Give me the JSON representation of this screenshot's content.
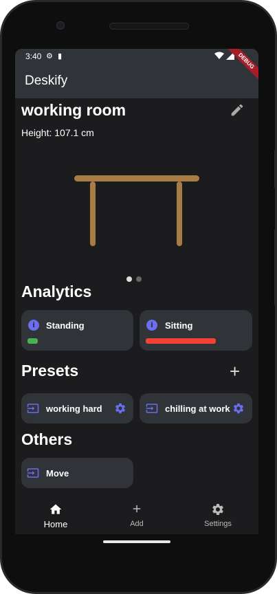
{
  "status": {
    "time": "3:40"
  },
  "appbar": {
    "title": "Deskify",
    "debug_banner": "DEBUG"
  },
  "room": {
    "name": "working room",
    "height_text": "Height: 107.1 cm"
  },
  "carousel": {
    "page_count": 2,
    "active_index": 0
  },
  "analytics": {
    "heading": "Analytics",
    "cards": [
      {
        "label": "Standing",
        "bar_color": "#4caf50",
        "ratio": 0.11
      },
      {
        "label": "Sitting",
        "bar_color": "#f44336",
        "ratio": 0.75
      }
    ]
  },
  "presets": {
    "heading": "Presets",
    "items": [
      {
        "label": "working hard"
      },
      {
        "label": "chilling at work"
      }
    ]
  },
  "others": {
    "heading": "Others",
    "items": [
      {
        "label": "Move"
      }
    ]
  },
  "nav": {
    "items": [
      {
        "label": "Home",
        "icon": "home-icon",
        "active": true
      },
      {
        "label": "Add",
        "icon": "plus-icon",
        "active": false
      },
      {
        "label": "Settings",
        "icon": "gear-icon",
        "active": false
      }
    ]
  },
  "colors": {
    "accent": "#6b6ef0",
    "desk": "#a87c45",
    "surface": "#303338",
    "background": "#1c1c1e"
  }
}
